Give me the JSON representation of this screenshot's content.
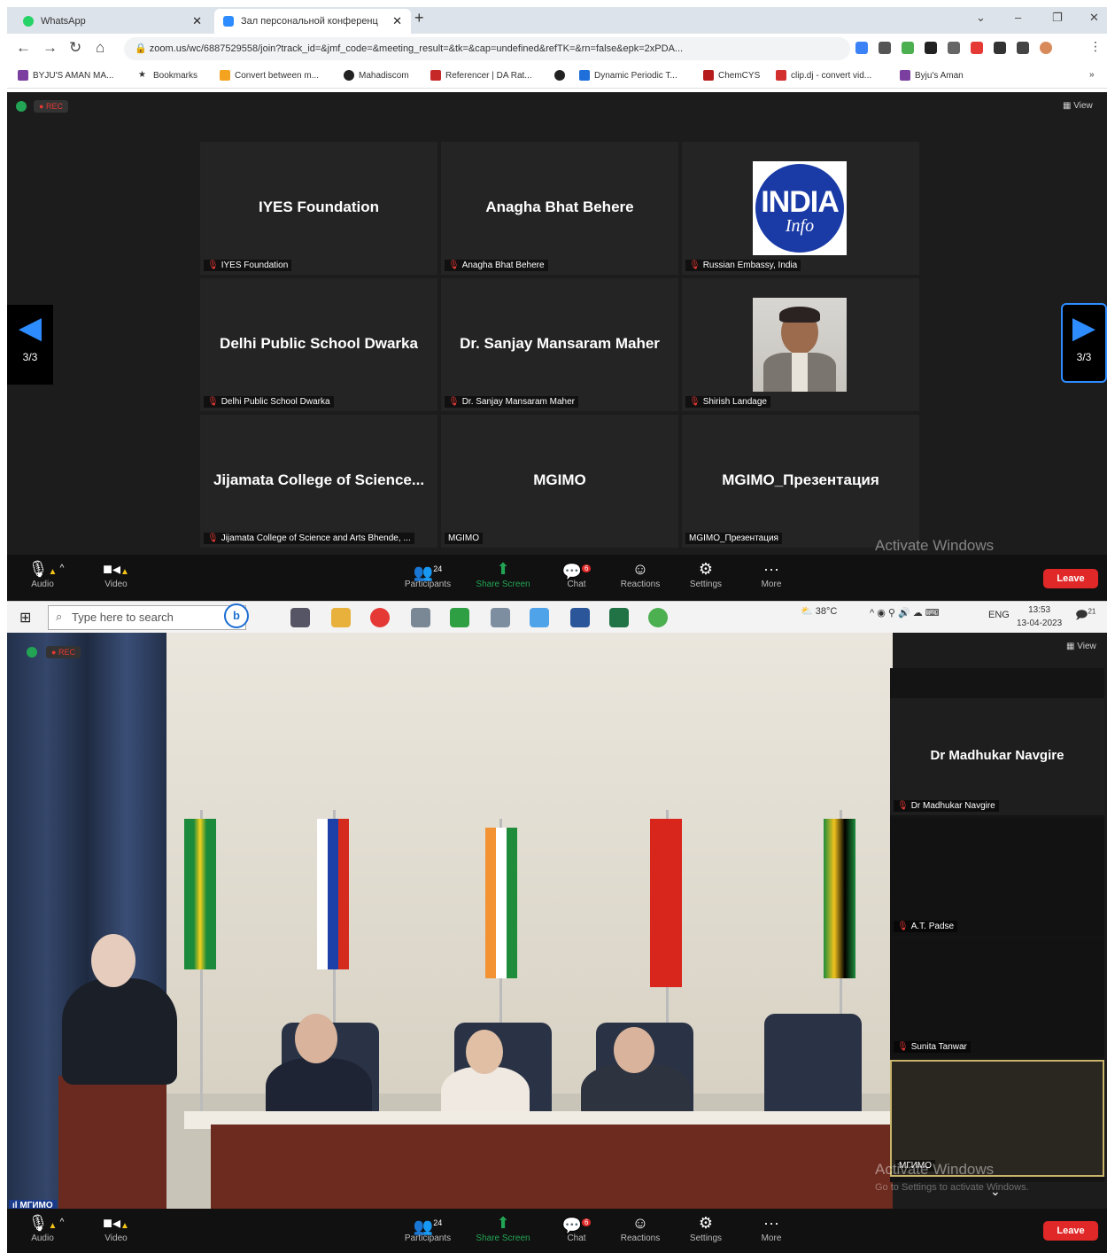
{
  "browser": {
    "tabs": [
      {
        "title": "WhatsApp"
      },
      {
        "title": "Зал персональной конференц"
      }
    ],
    "url": "zoom.us/wc/6887529558/join?track_id=&jmf_code=&meeting_result=&tk=&cap=undefined&refTK=&rn=false&epk=2xPDA...",
    "bookmarks": [
      "BYJU'S AMAN MA...",
      "Bookmarks",
      "Convert between m...",
      "Mahadiscom",
      "Referencer | DA Rat...",
      "Dynamic Periodic T...",
      "ChemCYS",
      "clip.dj - convert vid...",
      "Byju's Aman"
    ]
  },
  "meeting1": {
    "rec": "REC",
    "view": "View",
    "page": "3/3",
    "tiles": [
      {
        "name": "IYES Foundation",
        "label": "IYES Foundation"
      },
      {
        "name": "Anagha Bhat Behere",
        "label": "Anagha Bhat Behere"
      },
      {
        "name": "",
        "label": "Russian Embassy, India",
        "logo_top": "INDIA",
        "logo_bottom": "Info"
      },
      {
        "name": "Delhi Public School Dwarka",
        "label": "Delhi Public School Dwarka"
      },
      {
        "name": "Dr. Sanjay Mansaram Maher",
        "label": "Dr. Sanjay Mansaram Maher"
      },
      {
        "name": "",
        "label": "Shirish Landage"
      },
      {
        "name": "Jijamata College of Science...",
        "label": "Jijamata College of Science and Arts Bhende, ..."
      },
      {
        "name": "MGIMO",
        "label": "MGIMO"
      },
      {
        "name": "MGIMO_Презентация",
        "label": "MGIMO_Презентация"
      }
    ]
  },
  "toolbar": {
    "audio": "Audio",
    "video": "Video",
    "participants": "Participants",
    "participants_count": "24",
    "share": "Share Screen",
    "chat": "Chat",
    "chat_badge": "6",
    "reactions": "Reactions",
    "settings": "Settings",
    "more": "More",
    "leave": "Leave"
  },
  "watermark": {
    "line1": "Activate Windows",
    "line2": "Go to Settings to activate Windows."
  },
  "taskbar": {
    "search_placeholder": "Type here to search",
    "temp": "38°C",
    "lang": "ENG",
    "time": "13:53",
    "date": "13-04-2023",
    "notif": "21"
  },
  "meeting2": {
    "rec": "REC",
    "view": "View",
    "speaker_tag": "МГИМО",
    "side_tiles": [
      {
        "name": "Dr Madhukar Navgire",
        "label": "Dr Madhukar Navgire"
      },
      {
        "name": "",
        "label": "A.T. Padse"
      },
      {
        "name": "",
        "label": "Sunita Tanwar"
      },
      {
        "name": "",
        "label": "МГИМО"
      }
    ]
  }
}
